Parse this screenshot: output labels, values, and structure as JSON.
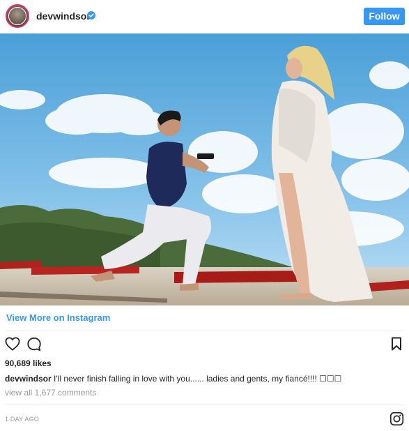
{
  "header": {
    "username": "devwindsor",
    "verified_icon": "verified-badge-icon",
    "follow_label": "Follow"
  },
  "colors": {
    "accent": "#3897f0",
    "text": "#262626",
    "muted": "#999999",
    "divider": "#efefef"
  },
  "photo": {
    "alt": "Proposal on the beach"
  },
  "view_more": "View More on Instagram",
  "actions": {
    "like_icon": "heart-icon",
    "comment_icon": "comment-icon",
    "save_icon": "bookmark-icon"
  },
  "post": {
    "likes": "90,689 likes",
    "caption_user": "devwindsor",
    "caption_text": " I'll never finish falling in love with you...... ladies and gents, my fiancé!!!! ☐☐☐",
    "comments": "view all 1,677 comments",
    "timestamp": "1 DAY AGO",
    "instagram_icon": "instagram-logo-icon"
  }
}
